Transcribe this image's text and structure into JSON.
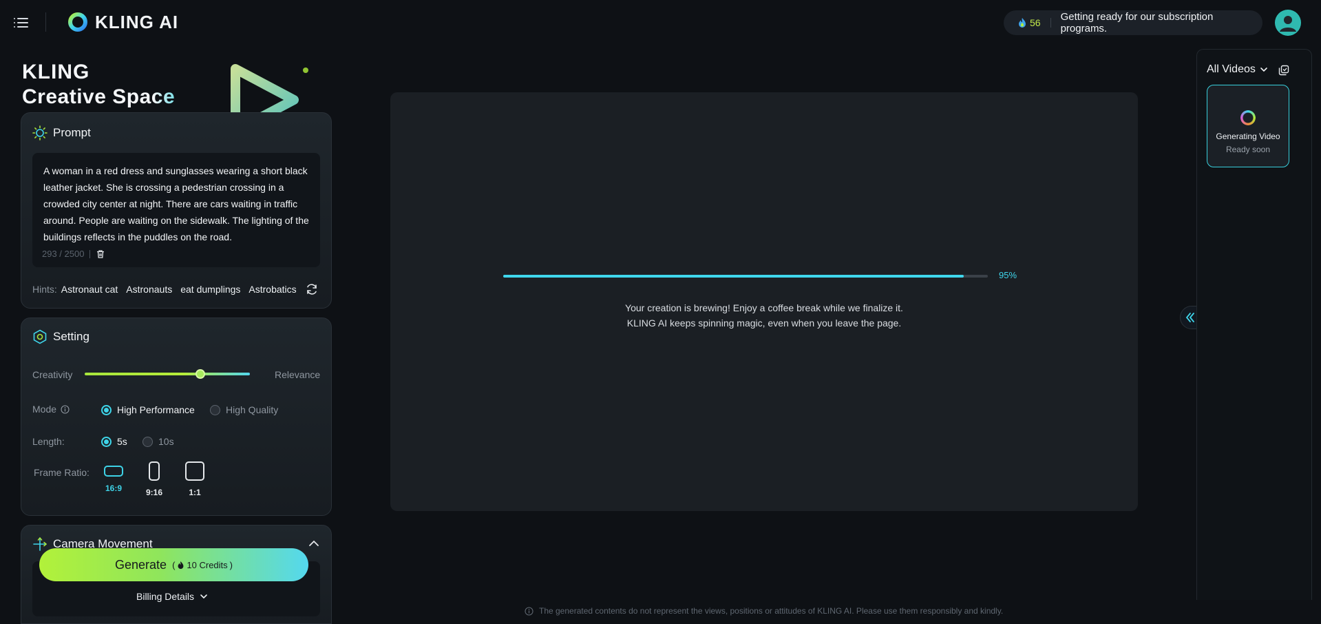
{
  "app": {
    "brand": "KLING AI"
  },
  "header": {
    "credits": "56",
    "announcement": "Getting ready for our subscription programs."
  },
  "hero": {
    "line1": "KLING",
    "line2_a": "Creative Sp",
    "line2_b": "ace"
  },
  "prompt": {
    "title": "Prompt",
    "text": "A woman in a red dress and sunglasses wearing a short black leather jacket. She is crossing a pedestrian crossing in a crowded city center at night. There are cars waiting in traffic around. People are waiting on the sidewalk. The lighting of the buildings reflects in the puddles on the road.",
    "counter": "293 / 2500",
    "hints_label": "Hints:",
    "hints": [
      "Astronaut cat",
      "Astronauts",
      "eat dumplings",
      "Astrobatics"
    ]
  },
  "settings": {
    "title": "Setting",
    "slider_left": "Creativity",
    "slider_right": "Relevance",
    "slider_value": 0.7,
    "mode_label": "Mode",
    "mode_options": [
      "High Performance",
      "High Quality"
    ],
    "mode_selected": "High Performance",
    "length_label": "Length:",
    "length_options": [
      "5s",
      "10s"
    ],
    "length_selected": "5s",
    "ratio_label": "Frame Ratio:",
    "ratios": [
      "16:9",
      "9:16",
      "1:1"
    ],
    "ratio_selected": "16:9"
  },
  "camera": {
    "title": "Camera Movement"
  },
  "generate": {
    "label": "Generate",
    "credits": "10 Credits",
    "open_paren": "(",
    "close_paren": ")"
  },
  "billing": {
    "label": "Billing Details"
  },
  "stage": {
    "progress": 0.95,
    "progress_label": "95%",
    "message_line1": "Your creation is brewing! Enjoy a coffee break while we finalize it.",
    "message_line2": "KLING AI keeps spinning magic, even when you leave the page."
  },
  "right_panel": {
    "title": "All Videos",
    "card_title": "Generating Video",
    "card_sub": "Ready soon"
  },
  "footer": {
    "disclaimer": "The generated contents do not represent the views, positions or attitudes of KLING AI. Please use them responsibly and kindly."
  },
  "colors": {
    "accent_cyan": "#3fd6ec",
    "accent_lime": "#b2f13a",
    "background": "#0e1115",
    "panel": "#1b1f24"
  },
  "icons": [
    "menu-icon",
    "kling-logo-icon",
    "flame-icon",
    "avatar-icon",
    "sun-icon",
    "trash-icon",
    "refresh-icon",
    "hexagon-icon",
    "info-icon",
    "camera-move-icon",
    "chevron-up-icon",
    "chevron-down-icon",
    "double-chevron-left-icon",
    "copy-icon"
  ]
}
